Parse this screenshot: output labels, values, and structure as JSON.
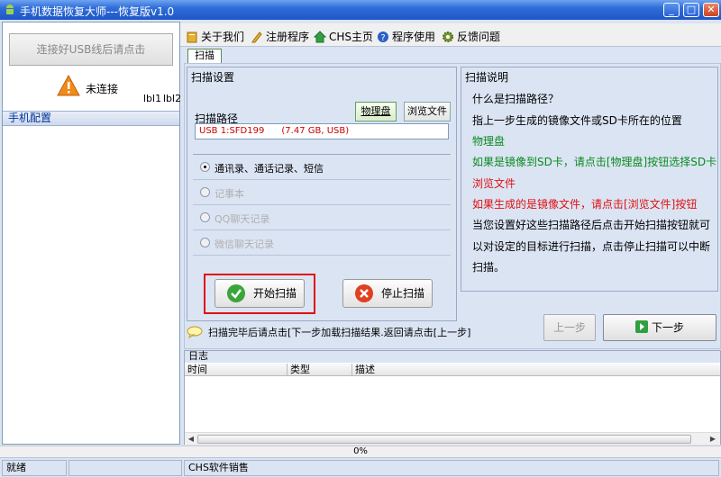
{
  "window": {
    "title": "手机数据恢复大师---恢复版v1.0",
    "minimize": "_",
    "maximize": "□",
    "close": "✕"
  },
  "left": {
    "connect_button": "连接好USB线后请点击",
    "status": "未连接",
    "lbl1": "lbl1",
    "lbl2": "lbl2",
    "config_header": "手机配置"
  },
  "toolbar": {
    "about": "关于我们",
    "register": "注册程序",
    "home": "CHS主页",
    "help": "程序使用",
    "feedback": "反馈问题"
  },
  "tabs": {
    "scan": "扫描"
  },
  "settings": {
    "title": "扫描设置",
    "path_label": "扫描路径",
    "physical_button": "物理盘",
    "browse_button": "浏览文件",
    "path_value": "USB 1:SFD199      (7.47 GB, USB)",
    "options": [
      {
        "label": "通讯录、通话记录、短信",
        "selected": true,
        "enabled": true
      },
      {
        "label": "记事本",
        "selected": false,
        "enabled": false
      },
      {
        "label": "QQ聊天记录",
        "selected": false,
        "enabled": false
      },
      {
        "label": "微信聊天记录",
        "selected": false,
        "enabled": false
      }
    ],
    "start_button": "开始扫描",
    "stop_button": "停止扫描"
  },
  "description": {
    "title": "扫描说明",
    "lines": [
      "什么是扫描路径？",
      "指上一步生成的镜像文件或SD卡所在的位置",
      "物理盘",
      "如果是镜像到SD卡，请点击[物理盘]按钮选择SD卡",
      "浏览文件",
      "如果生成的是镜像文件，请点击[浏览文件]按钮",
      "当您设置好这些扫描路径后点击开始扫描按钮就可",
      "以对设定的目标进行扫描，点击停止扫描可以中断",
      "扫描。"
    ]
  },
  "hint": "扫描完毕后请点击[下一步加载扫描结果.返回请点击[上一步]",
  "nav": {
    "prev": "上一步",
    "next": "下一步"
  },
  "log": {
    "title": "日志",
    "columns": [
      "时间",
      "类型",
      "描述"
    ]
  },
  "progress": {
    "text": "0%",
    "value": 0
  },
  "status": {
    "left": "就绪",
    "middle": "CHS软件销售"
  },
  "colors": {
    "title_blue": "#2f6dd8",
    "green_text": "#0a8a20",
    "red_text": "#e01010",
    "highlight_box": "#e01010"
  }
}
